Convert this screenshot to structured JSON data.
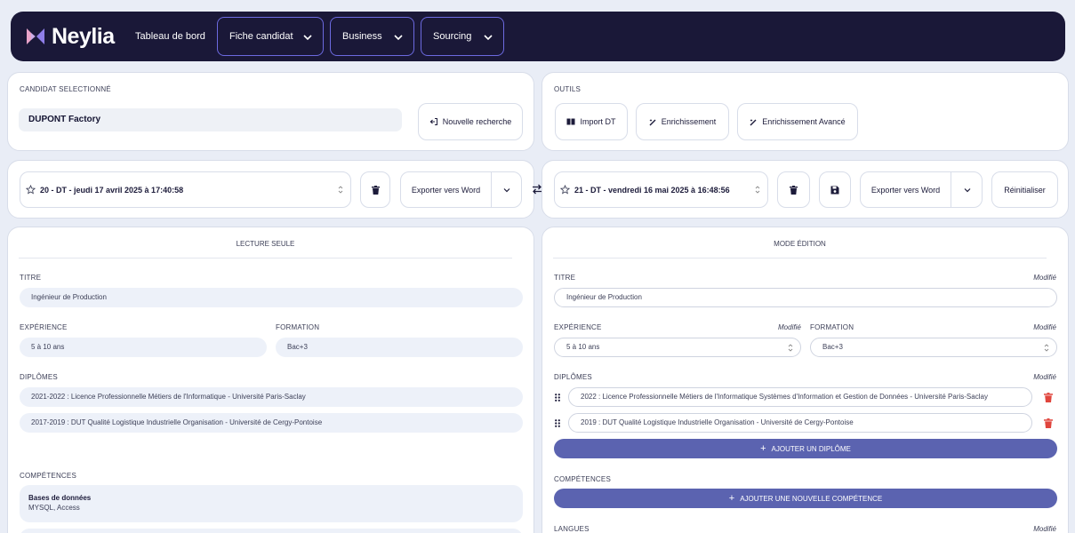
{
  "nav": {
    "brand": "Neylia",
    "links": {
      "dashboard": "Tableau de bord"
    },
    "dropdowns": [
      "Fiche candidat",
      "Business",
      "Sourcing"
    ]
  },
  "candidate": {
    "label": "CANDIDAT SELECTIONNÉ",
    "value": "DUPONT Factory",
    "new_search": "Nouvelle recherche"
  },
  "tools": {
    "label": "OUTILS",
    "buttons": [
      "Import DT",
      "Enrichissement",
      "Enrichissement Avancé"
    ]
  },
  "left_version": {
    "selected": "20 - DT - jeudi 17 avril 2025 à 17:40:58",
    "export_label": "Exporter vers Word"
  },
  "right_version": {
    "selected": "21 - DT - vendredi 16 mai 2025 à 16:48:56",
    "export_label": "Exporter vers Word",
    "reset_label": "Réinitialiser"
  },
  "readonly": {
    "mode": "LECTURE SEULE",
    "titre_label": "TITRE",
    "titre": "Ingénieur de Production",
    "experience_label": "EXPÉRIENCE",
    "experience": "5 à 10 ans",
    "formation_label": "FORMATION",
    "formation": "Bac+3",
    "diplomes_label": "DIPLÔMES",
    "diplomes": [
      "2021-2022 : Licence Professionnelle Métiers de l'Informatique - Université Paris-Saclay",
      "2017-2019 : DUT Qualité Logistique Industrielle Organisation - Université de Cergy-Pontoise"
    ],
    "competences_label": "COMPÉTENCES",
    "competences": [
      {
        "title": "Bases de données",
        "items": "MYSQL, Access"
      }
    ]
  },
  "edit": {
    "mode": "MODE ÉDITION",
    "modified": "Modifié",
    "titre_label": "TITRE",
    "titre": "Ingénieur de Production",
    "experience_label": "EXPÉRIENCE",
    "experience": "5 à 10 ans",
    "formation_label": "FORMATION",
    "formation": "Bac+3",
    "diplomes_label": "DIPLÔMES",
    "diplomes": [
      "2022 : Licence Professionnelle Métiers de l'Informatique Systèmes d'Information et Gestion de Données - Université Paris-Saclay",
      "2019 : DUT Qualité Logistique Industrielle Organisation - Université de Cergy-Pontoise"
    ],
    "add_diplome": "AJOUTER UN DIPLÔME",
    "competences_label": "COMPÉTENCES",
    "add_competence": "AJOUTER UNE NOUVELLE COMPÉTENCE",
    "langues_label": "LANGUES"
  },
  "colors": {
    "nav_bg": "#1a1838",
    "accent": "#6c6ae0",
    "add_button": "#5b63b0",
    "delete": "#e0453d",
    "logo_pink": "#e8a3c9",
    "logo_violet": "#8f7ee8"
  }
}
